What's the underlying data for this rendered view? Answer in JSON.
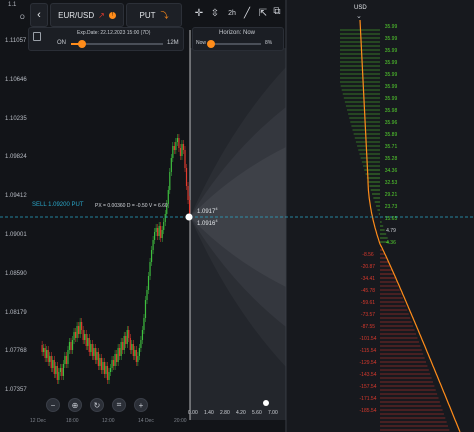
{
  "colors": {
    "background": "#121418",
    "candle_up": "#3fbf3f",
    "candle_down": "#e33b2e",
    "accent": "#ff8c1a",
    "sell_line": "#2aa7c9",
    "grid_green": "#55d22f",
    "grid_red": "#d9392d"
  },
  "price_axis": {
    "labels": [
      "1.11057",
      "1.10646",
      "1.10235",
      "1.09824",
      "1.09412",
      "1.09001",
      "1.08590",
      "1.08179",
      "1.07768",
      "1.07357"
    ],
    "partial_top_labels": [
      "1.1",
      "O"
    ]
  },
  "toolbar": {
    "back_icon": "chevron-left-icon",
    "pair_label": "EUR/USD",
    "pair_icon": "trend-up-icon",
    "badge_icon": "alert-badge-icon",
    "direction_label": "PUT",
    "direction_icon": "curve-down-icon",
    "tools": [
      "crosshair-icon",
      "move-icon",
      "2h",
      "pencil-icon",
      "export-icon"
    ]
  },
  "expiry_panel": {
    "icon": "calculator-icon",
    "exp_date": "Exp.Date: 22.12.2023 15:00 (7D)",
    "left_label": "ON",
    "right_label": "12M",
    "slider_fraction": 0.12
  },
  "horizon_panel": {
    "title": "Horizon: Now",
    "left_label": "Now",
    "right_label": "8%",
    "slider_fraction": 0.0
  },
  "position": {
    "label": "SELL 1.09200 PUT",
    "greeks": "PX = 0.00360 D = -0.50 V = 6.60",
    "price_1": "1.0917",
    "price_1_sup": "4",
    "price_2": "1.0916",
    "price_2_sup": "4"
  },
  "time_axis": {
    "left_labels": [
      "12 Dec",
      "",
      "18:00",
      "",
      "12:00",
      "",
      "14 Dec",
      "",
      "20:00"
    ],
    "right_labels": [
      "0.00",
      "1.40",
      "2.80",
      "4.20",
      "5.60",
      "7.00"
    ]
  },
  "right_panel": {
    "currency": "USD",
    "icon": "chevron-down-icon",
    "green_values": [
      "35.99",
      "35.99",
      "35.99",
      "35.99",
      "35.99",
      "35.99",
      "35.99",
      "35.98",
      "35.96",
      "35.89",
      "35.71",
      "35.28",
      "34.36",
      "32.53",
      "29.21",
      "23.73",
      "15.65"
    ],
    "mid_value_1": "4.79",
    "mid_value_2": "4.36",
    "red_values": [
      "-8.56",
      "-20.87",
      "-34.41",
      "-45.78",
      "-59.61",
      "-73.57",
      "-87.55",
      "-101.54",
      "-115.54",
      "-129.54",
      "-143.54",
      "-157.54",
      "-171.54",
      "-185.54"
    ]
  },
  "bottom_controls": [
    "minus-icon",
    "target-icon",
    "refresh-icon",
    "crop-icon",
    "plus-icon"
  ]
}
